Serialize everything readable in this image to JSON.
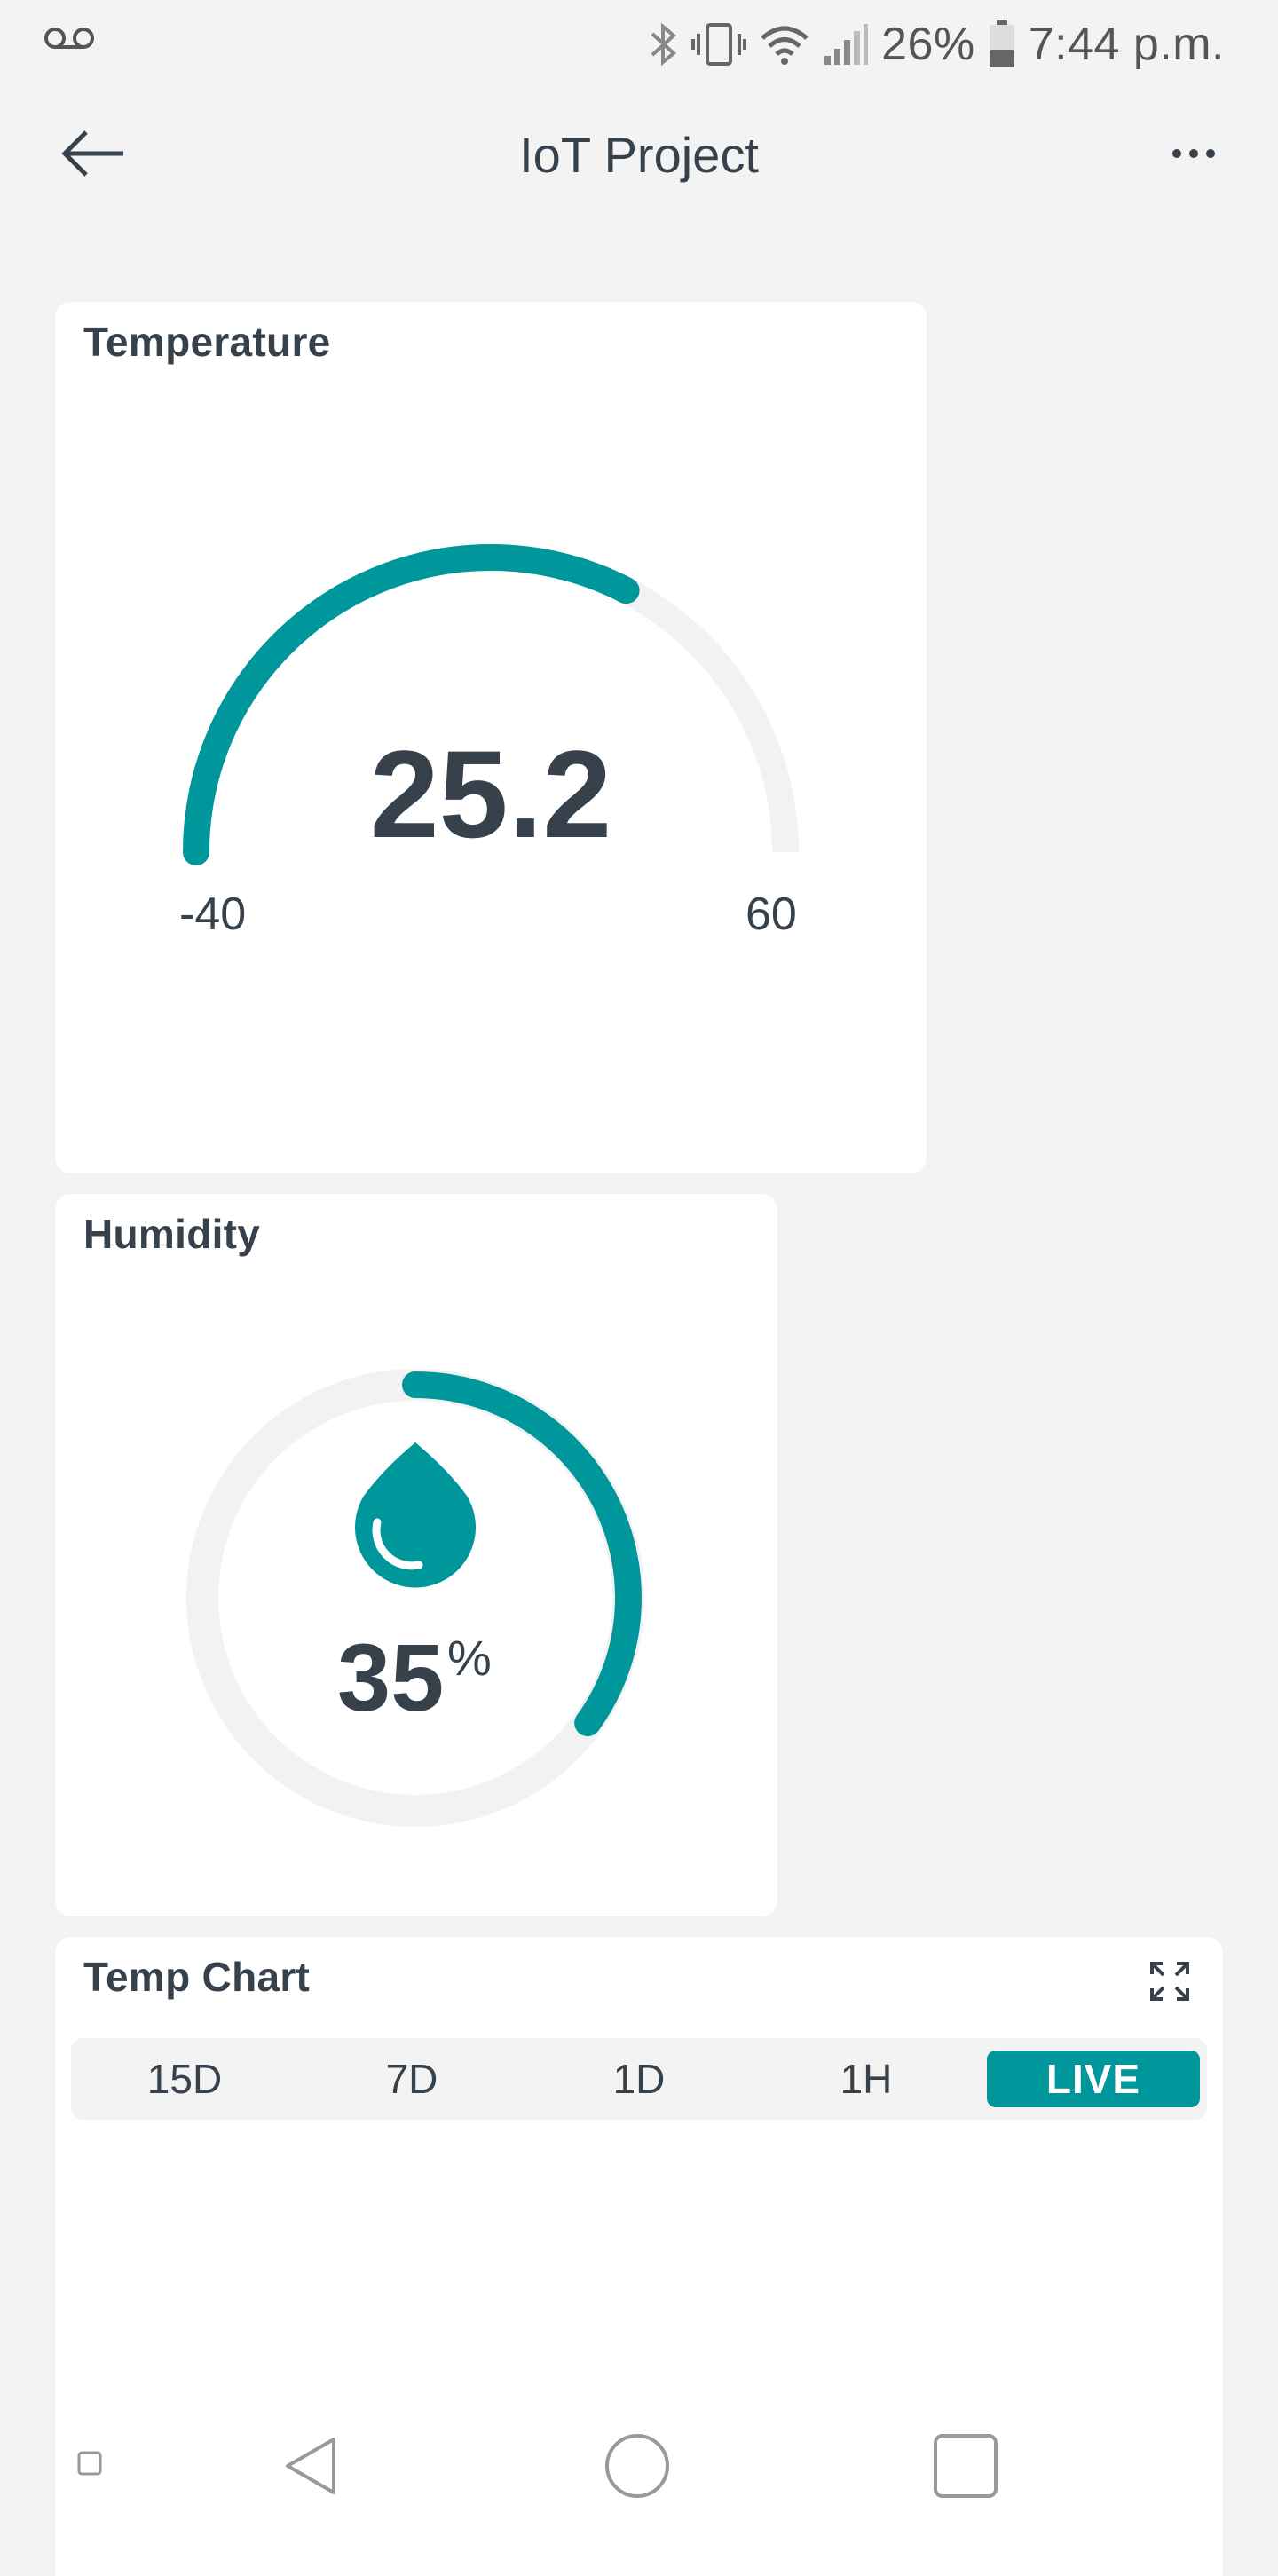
{
  "status_bar": {
    "battery": "26%",
    "time": "7:44 p.m.",
    "icons": [
      "voicemail-icon",
      "bluetooth-icon",
      "vibrate-icon",
      "wifi-icon",
      "signal-icon",
      "battery-icon"
    ]
  },
  "app_bar": {
    "title": "IoT Project",
    "back_icon": "arrow-left-icon",
    "more_icon": "more-horizontal-icon"
  },
  "temperature_widget": {
    "title": "Temperature",
    "value": "25.2",
    "min": "-40",
    "max": "60",
    "value_number": 25.2,
    "min_number": -40,
    "max_number": 60
  },
  "humidity_widget": {
    "title": "Humidity",
    "value": "35",
    "unit": "%",
    "fraction": 0.35,
    "icon": "water-drop-icon"
  },
  "chart_widget": {
    "title": "Temp Chart",
    "expand_icon": "expand-icon",
    "ranges": [
      "15D",
      "7D",
      "1D",
      "1H",
      "LIVE"
    ],
    "selected_range": "LIVE"
  },
  "nav_bar": {
    "icons": [
      "small-square-icon",
      "back-triangle-icon",
      "home-circle-icon",
      "recents-square-icon"
    ]
  },
  "colors": {
    "accent": "#00979c",
    "track": "#f2f2f2",
    "text": "#37414b",
    "background": "#f3f3f3"
  }
}
